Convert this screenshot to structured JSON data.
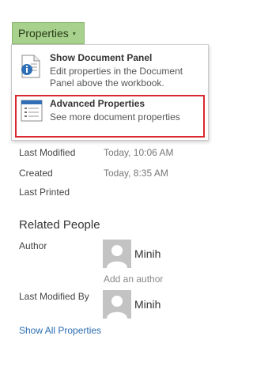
{
  "properties_button": {
    "label": "Properties",
    "caret": "▾"
  },
  "menu": {
    "items": [
      {
        "title": "Show Document Panel",
        "desc_line1": "Edit properties in the Document",
        "desc_line2": "Panel above the workbook.",
        "icon": "document-panel-icon"
      },
      {
        "title": "Advanced Properties",
        "desc_line1": "See more document properties",
        "icon": "advanced-properties-icon"
      }
    ]
  },
  "dates": [
    {
      "label": "Last Modified",
      "value": "Today, 10:06 AM"
    },
    {
      "label": "Created",
      "value": "Today, 8:35 AM"
    },
    {
      "label": "Last Printed",
      "value": ""
    }
  ],
  "related_people": {
    "title": "Related People",
    "author_label": "Author",
    "author_name": "Minih",
    "add_author_placeholder": "Add an author",
    "last_modified_by_label": "Last Modified By",
    "last_modified_by_name": "Minih"
  },
  "show_all_link": "Show All Properties",
  "colors": {
    "button_bg": "#a9d18e",
    "highlight_border": "#d9282f",
    "link": "#2b6cb0"
  }
}
